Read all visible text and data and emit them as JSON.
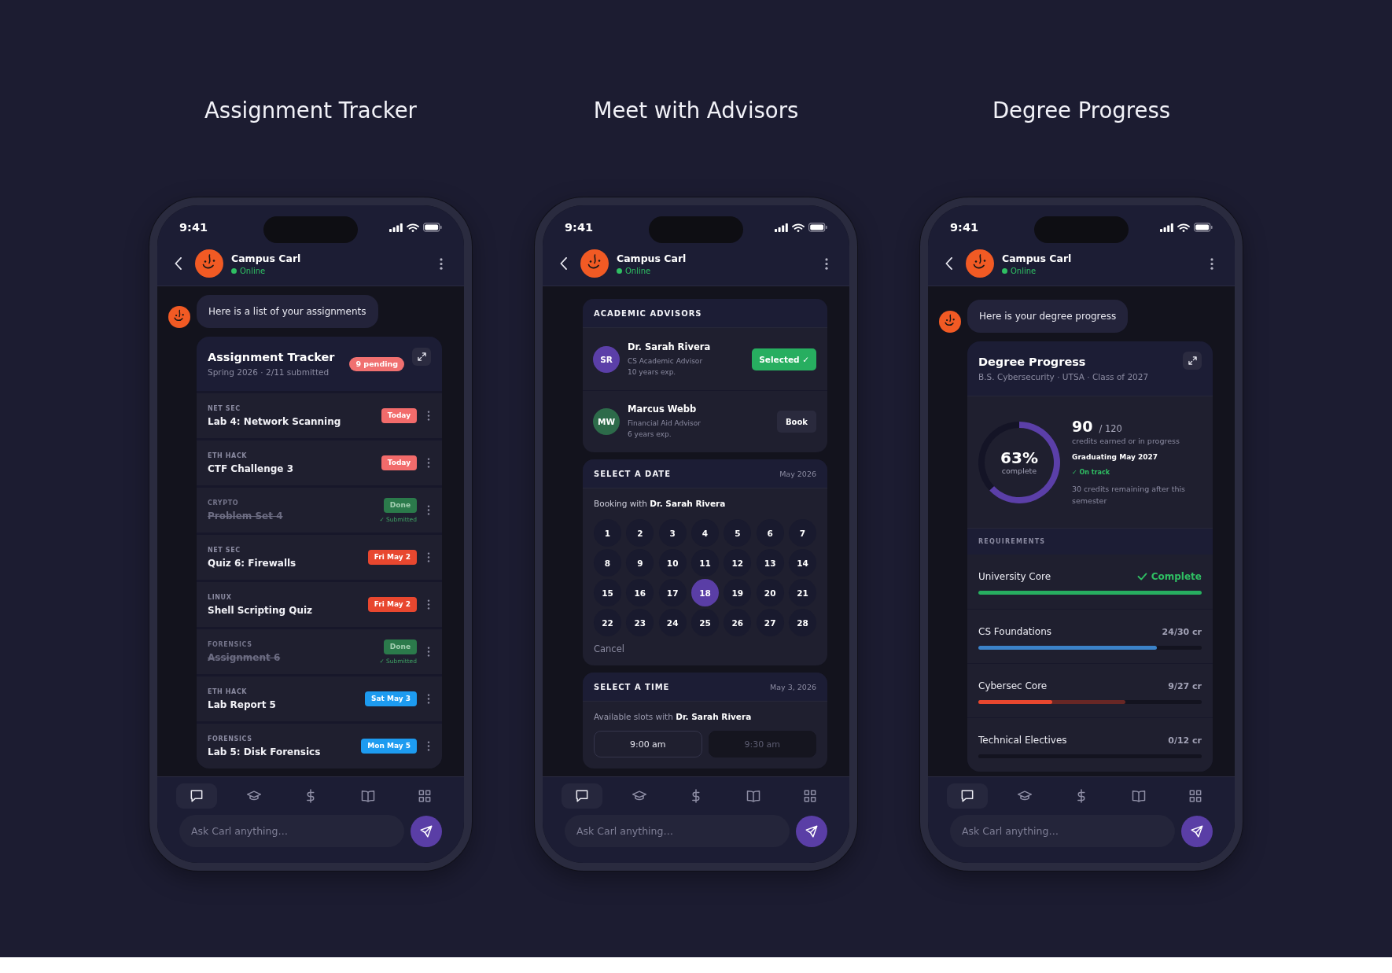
{
  "screens": [
    {
      "heading": "Assignment Tracker",
      "status_bar": {
        "time": "9:41"
      },
      "chat_header": {
        "name": "Campus Carl",
        "status": "Online"
      },
      "message": "Here is a list of your assignments",
      "tracker": {
        "title": "Assignment Tracker",
        "subtitle": "Spring 2026 · 2/11 submitted",
        "badge": "9 pending",
        "items": [
          {
            "course": "NET SEC",
            "title": "Lab 4: Network Scanning",
            "due": "Today",
            "color": "#f26b6b",
            "done": false
          },
          {
            "course": "ETH HACK",
            "title": "CTF Challenge 3",
            "due": "Today",
            "color": "#f26b6b",
            "done": false
          },
          {
            "course": "CRYPTO",
            "title": "Problem Set 4",
            "due": "Done",
            "color": "#2b7a4b",
            "done": true,
            "note": "✓ Submitted"
          },
          {
            "course": "NET SEC",
            "title": "Quiz 6: Firewalls",
            "due": "Fri May 2",
            "color": "#e8472f",
            "done": false
          },
          {
            "course": "LINUX",
            "title": "Shell Scripting Quiz",
            "due": "Fri May 2",
            "color": "#e8472f",
            "done": false
          },
          {
            "course": "FORENSICS",
            "title": "Assignment 6",
            "due": "Done",
            "color": "#2b7a4b",
            "done": true,
            "note": "✓ Submitted"
          },
          {
            "course": "ETH HACK",
            "title": "Lab Report 5",
            "due": "Sat May 3",
            "color": "#1d9bf0",
            "done": false
          },
          {
            "course": "FORENSICS",
            "title": "Lab 5: Disk Forensics",
            "due": "Mon May 5",
            "color": "#1d9bf0",
            "done": false
          }
        ]
      },
      "nav": [
        {
          "kind": "chat",
          "selected": true
        },
        {
          "kind": "academics",
          "selected": false
        },
        {
          "kind": "finance",
          "selected": false
        },
        {
          "kind": "library",
          "selected": false
        },
        {
          "kind": "apps",
          "selected": false
        }
      ],
      "composer": {
        "placeholder": "Ask Carl anything…"
      }
    },
    {
      "heading": "Meet with Advisors",
      "status_bar": {
        "time": "9:41"
      },
      "chat_header": {
        "name": "Campus Carl",
        "status": "Online"
      },
      "advisors": {
        "title": "ACADEMIC ADVISORS",
        "items": [
          {
            "initials": "SR",
            "color": "#5b3fa8",
            "name": "Dr. Sarah Rivera",
            "role": "CS Academic Advisor",
            "experience": "10 years exp.",
            "action": "Selected ✓",
            "selected": true
          },
          {
            "initials": "MW",
            "color": "#2d6b4a",
            "name": "Marcus Webb",
            "role": "Financial Aid Advisor",
            "experience": "6 years exp.",
            "action": "Book",
            "selected": false
          }
        ]
      },
      "date_picker": {
        "title": "SELECT A DATE",
        "month": "May 2026",
        "booking_with": "Booking with **Dr. Sarah Rivera**",
        "days": [
          {
            "label": "1",
            "selected": false
          },
          {
            "label": "2",
            "selected": false
          },
          {
            "label": "3",
            "selected": false
          },
          {
            "label": "4",
            "selected": false
          },
          {
            "label": "5",
            "selected": false
          },
          {
            "label": "6",
            "selected": false
          },
          {
            "label": "7",
            "selected": false
          },
          {
            "label": "8",
            "selected": false
          },
          {
            "label": "9",
            "selected": false
          },
          {
            "label": "10",
            "selected": false
          },
          {
            "label": "11",
            "selected": false
          },
          {
            "label": "12",
            "selected": false
          },
          {
            "label": "13",
            "selected": false
          },
          {
            "label": "14",
            "selected": false
          },
          {
            "label": "15",
            "selected": false
          },
          {
            "label": "16",
            "selected": false
          },
          {
            "label": "17",
            "selected": false
          },
          {
            "label": "18",
            "selected": true
          },
          {
            "label": "19",
            "selected": false
          },
          {
            "label": "20",
            "selected": false
          },
          {
            "label": "21",
            "selected": false
          },
          {
            "label": "22",
            "selected": false
          },
          {
            "label": "23",
            "selected": false
          },
          {
            "label": "24",
            "selected": false
          },
          {
            "label": "25",
            "selected": false
          },
          {
            "label": "26",
            "selected": false
          },
          {
            "label": "27",
            "selected": false
          },
          {
            "label": "28",
            "selected": false
          }
        ],
        "cancel": "Cancel"
      },
      "time_picker": {
        "title": "SELECT A TIME",
        "date": "May 3, 2026",
        "available_with": "Available slots with **Dr. Sarah Rivera**",
        "slots": [
          {
            "label": "9:00 am",
            "disabled": false
          },
          {
            "label": "9:30 am",
            "disabled": true
          }
        ]
      },
      "nav": [
        {
          "kind": "chat",
          "selected": true
        },
        {
          "kind": "academics",
          "selected": false
        },
        {
          "kind": "finance",
          "selected": false
        },
        {
          "kind": "library",
          "selected": false
        },
        {
          "kind": "apps",
          "selected": false
        }
      ],
      "composer": {
        "placeholder": "Ask Carl anything…"
      }
    },
    {
      "heading": "Degree Progress",
      "status_bar": {
        "time": "9:41"
      },
      "chat_header": {
        "name": "Campus Carl",
        "status": "Online"
      },
      "message": "Here is your degree progress",
      "degree": {
        "title": "Degree Progress",
        "subtitle": "B.S. Cybersecurity · UTSA · Class of 2027",
        "progress": {
          "percent": "63%",
          "caption": "complete",
          "chart_data": {
            "type": "donut",
            "values": [
              63,
              37
            ],
            "colors": [
              "#5b3fa8",
              "#141426"
            ]
          }
        },
        "credits": "90",
        "credits_total": "/ 120",
        "credits_caption": "credits earned or in progress",
        "graduation": "Graduating May 2027",
        "on_track": "✓ On track",
        "remaining": "30 credits remaining after this semester",
        "requirements_title": "REQUIREMENTS",
        "requirements": [
          {
            "name": "University Core",
            "status": "Complete",
            "complete": true,
            "level": 1,
            "color": "#27ae60"
          },
          {
            "name": "CS Foundations",
            "status": "24/30 cr",
            "complete": false,
            "level": 0.8,
            "color": "#3b82c8"
          },
          {
            "name": "Cybersec Core",
            "status": "9/27 cr",
            "complete": false,
            "level": 0.33,
            "in_progress": {
              "level": 0.66
            },
            "color": "#e8472f"
          },
          {
            "name": "Technical Electives",
            "status": "0/12 cr",
            "complete": false
          }
        ]
      },
      "nav": [
        {
          "kind": "chat",
          "selected": true
        },
        {
          "kind": "academics",
          "selected": false
        },
        {
          "kind": "finance",
          "selected": false
        },
        {
          "kind": "library",
          "selected": false
        },
        {
          "kind": "apps",
          "selected": false
        }
      ],
      "composer": {
        "placeholder": "Ask Carl anything…"
      }
    }
  ]
}
